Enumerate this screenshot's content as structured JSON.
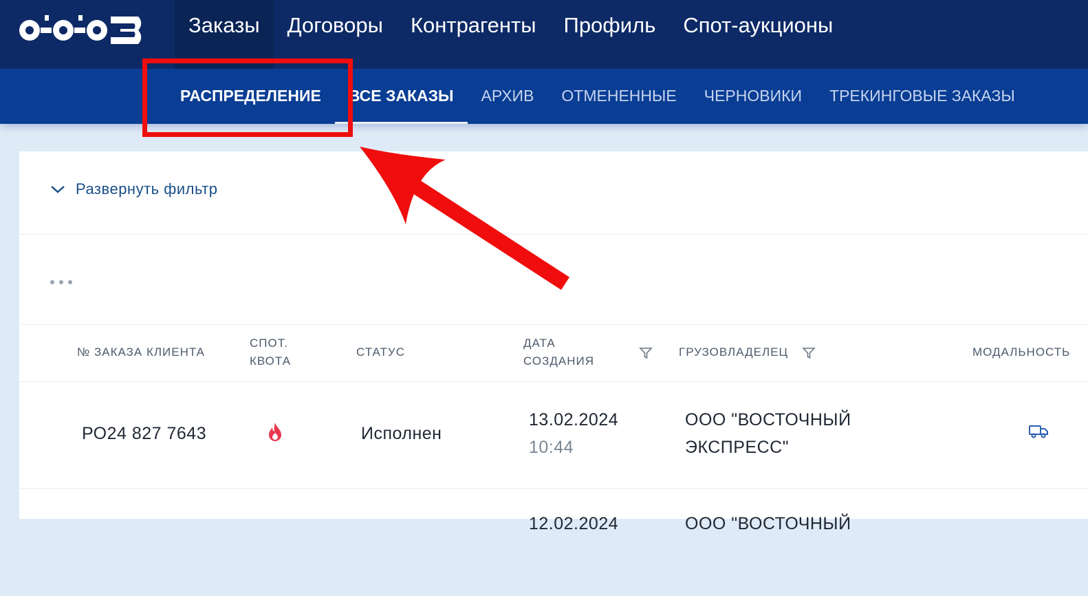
{
  "topnav": {
    "items": [
      {
        "label": "Заказы"
      },
      {
        "label": "Договоры"
      },
      {
        "label": "Контрагенты"
      },
      {
        "label": "Профиль"
      },
      {
        "label": "Спот-аукционы"
      }
    ]
  },
  "subnav": {
    "items": [
      {
        "label": "РАСПРЕДЕЛЕНИЕ"
      },
      {
        "label": "ВСЕ ЗАКАЗЫ"
      },
      {
        "label": "АРХИВ"
      },
      {
        "label": "ОТМЕНЕННЫЕ"
      },
      {
        "label": "ЧЕРНОВИКИ"
      },
      {
        "label": "ТРЕКИНГОВЫЕ ЗАКАЗЫ"
      }
    ]
  },
  "filter": {
    "label": "Развернуть фильтр",
    "icon": "chevron-down-icon"
  },
  "table": {
    "columns": [
      {
        "label": "№ ЗАКАЗА КЛИЕНТА"
      },
      {
        "label_1": "СПОТ.",
        "label_2": "КВОТА"
      },
      {
        "label": "СТАТУС"
      },
      {
        "label_1": "ДАТА",
        "label_2": "СОЗДАНИЯ"
      },
      {
        "label": "ГРУЗОВЛАДЕЛЕЦ"
      },
      {
        "label": "МОДАЛЬНОСТЬ"
      }
    ],
    "rows": [
      {
        "order": "РО24 827 7643",
        "quota_icon": "fire-icon",
        "status": "Исполнен",
        "date": "13.02.2024",
        "time": "10:44",
        "owner_1": "ООО \"ВОСТОЧНЫЙ",
        "owner_2": "ЭКСПРЕСС\"",
        "modality_icon": "truck-icon"
      },
      {
        "date": "12.02.2024",
        "owner_1": "ООО \"ВОСТОЧНЫЙ"
      }
    ]
  },
  "colors": {
    "topbar": "#0d2a66",
    "subbar": "#0a3d94",
    "highlight": "#f00d0d",
    "link": "#1a4f8a"
  }
}
